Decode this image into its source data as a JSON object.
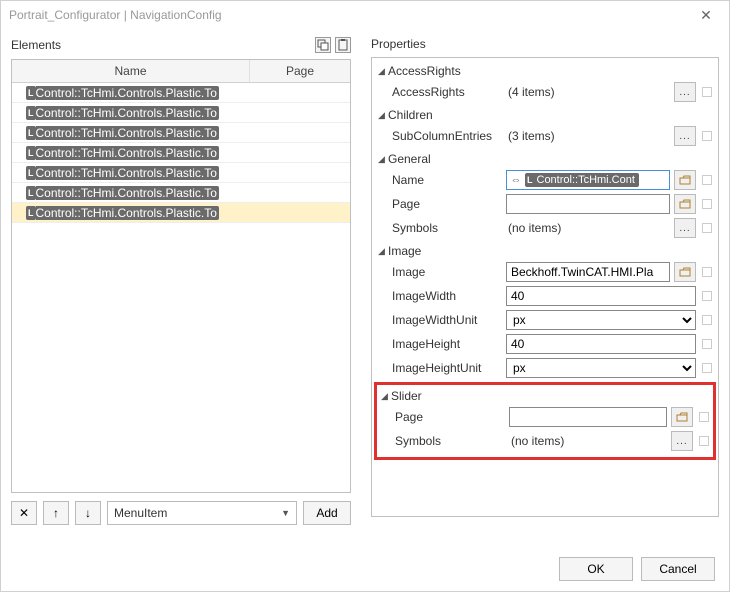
{
  "window": {
    "title": "Portrait_Configurator | NavigationConfig"
  },
  "elements": {
    "label": "Elements",
    "columns": {
      "name": "Name",
      "page": "Page"
    },
    "rows": [
      {
        "name": "Control::TcHmi.Controls.Plastic.To",
        "selected": false
      },
      {
        "name": "Control::TcHmi.Controls.Plastic.To",
        "selected": false
      },
      {
        "name": "Control::TcHmi.Controls.Plastic.To",
        "selected": false
      },
      {
        "name": "Control::TcHmi.Controls.Plastic.To",
        "selected": false
      },
      {
        "name": "Control::TcHmi.Controls.Plastic.To",
        "selected": false
      },
      {
        "name": "Control::TcHmi.Controls.Plastic.To",
        "selected": false
      },
      {
        "name": "Control::TcHmi.Controls.Plastic.To",
        "selected": true
      }
    ],
    "combo": "MenuItem",
    "add": "Add"
  },
  "properties": {
    "label": "Properties",
    "groups": {
      "accessRights": {
        "title": "AccessRights",
        "items": {
          "accessRights": {
            "label": "AccessRights",
            "value": "(4 items)"
          }
        }
      },
      "children": {
        "title": "Children",
        "items": {
          "subColumnEntries": {
            "label": "SubColumnEntries",
            "value": "(3 items)"
          }
        }
      },
      "general": {
        "title": "General",
        "items": {
          "name": {
            "label": "Name",
            "chip": "Control::TcHmi.Cont"
          },
          "page": {
            "label": "Page",
            "value": ""
          },
          "symbols": {
            "label": "Symbols",
            "value": "(no items)"
          }
        }
      },
      "image": {
        "title": "Image",
        "items": {
          "image": {
            "label": "Image",
            "value": "Beckhoff.TwinCAT.HMI.Pla"
          },
          "imageWidth": {
            "label": "ImageWidth",
            "value": "40"
          },
          "imageWidthUnit": {
            "label": "ImageWidthUnit",
            "value": "px"
          },
          "imageHeight": {
            "label": "ImageHeight",
            "value": "40"
          },
          "imageHeightUnit": {
            "label": "ImageHeightUnit",
            "value": "px"
          }
        }
      },
      "slider": {
        "title": "Slider",
        "items": {
          "page": {
            "label": "Page",
            "value": ""
          },
          "symbols": {
            "label": "Symbols",
            "value": "(no items)"
          }
        }
      }
    }
  },
  "buttons": {
    "ok": "OK",
    "cancel": "Cancel"
  },
  "badge": "L"
}
